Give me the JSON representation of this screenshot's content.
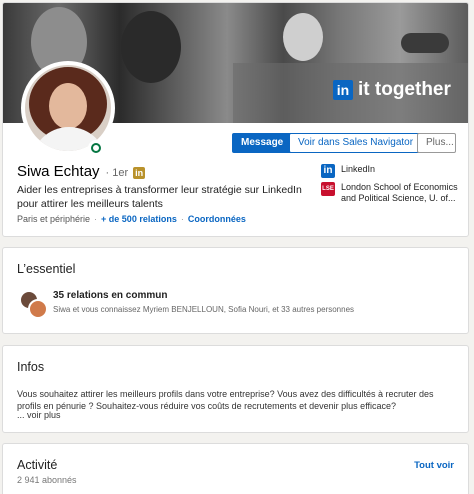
{
  "profile": {
    "banner_tagline": "it together",
    "banner_logo": "in",
    "name": "Siwa Echtay",
    "degree": "· 1er",
    "badge_icon": "in",
    "headline": "Aider les entreprises à transformer leur stratégie sur LinkedIn pour attirer les meilleurs talents",
    "location": "Paris et périphérie",
    "relations": "+ de 500 relations",
    "contact": "Coordonnées",
    "buttons": {
      "message": "Message",
      "sales_navigator": "Voir dans Sales Navigator",
      "more": "Plus..."
    },
    "side": [
      {
        "icon": "in",
        "text": "LinkedIn"
      },
      {
        "icon": "LSE",
        "text": "London School of Economics and Political Science, U. of..."
      }
    ]
  },
  "essentiel": {
    "title": "L’essentiel",
    "relations_title": "35 relations en commun",
    "relations_sub": "Siwa et vous connaissez Myriem BENJELLOUN, Sofia Nouri, et 33 autres personnes"
  },
  "infos": {
    "title": "Infos",
    "text": "Vous souhaitez attirer les meilleurs profils dans votre entreprise? Vous avez des difficultés à recruter des profils en pénurie ? Souhaitez-vous réduire vos coûts de recrutements et devenir plus efficace?",
    "more": "... voir plus"
  },
  "activite": {
    "title": "Activité",
    "see_all": "Tout voir",
    "followers": "2 941 abonnés"
  },
  "colors": {
    "brand": "#0a66c2",
    "online": "#057642",
    "lse": "#c8102e"
  }
}
